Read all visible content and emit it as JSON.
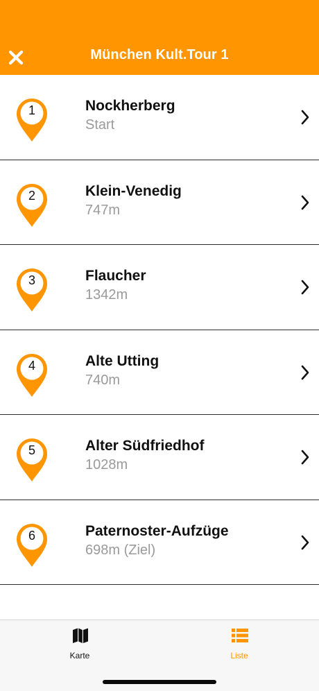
{
  "colors": {
    "accent": "#FF9500",
    "subtitle": "#9a9a9a",
    "text": "#111111"
  },
  "header": {
    "title": "München Kult.Tour 1",
    "close_icon": "close-icon"
  },
  "stops": [
    {
      "number": "1",
      "title": "Nockherberg",
      "subtitle": "Start"
    },
    {
      "number": "2",
      "title": "Klein-Venedig",
      "subtitle": "747m"
    },
    {
      "number": "3",
      "title": "Flaucher",
      "subtitle": "1342m"
    },
    {
      "number": "4",
      "title": "Alte Utting",
      "subtitle": "740m"
    },
    {
      "number": "5",
      "title": "Alter Südfriedhof",
      "subtitle": "1028m"
    },
    {
      "number": "6",
      "title": "Paternoster-Aufzüge",
      "subtitle": "698m (Ziel)"
    }
  ],
  "tabbar": {
    "karte": {
      "label": "Karte",
      "icon": "map-icon"
    },
    "liste": {
      "label": "Liste",
      "icon": "list-icon",
      "active": true
    }
  }
}
